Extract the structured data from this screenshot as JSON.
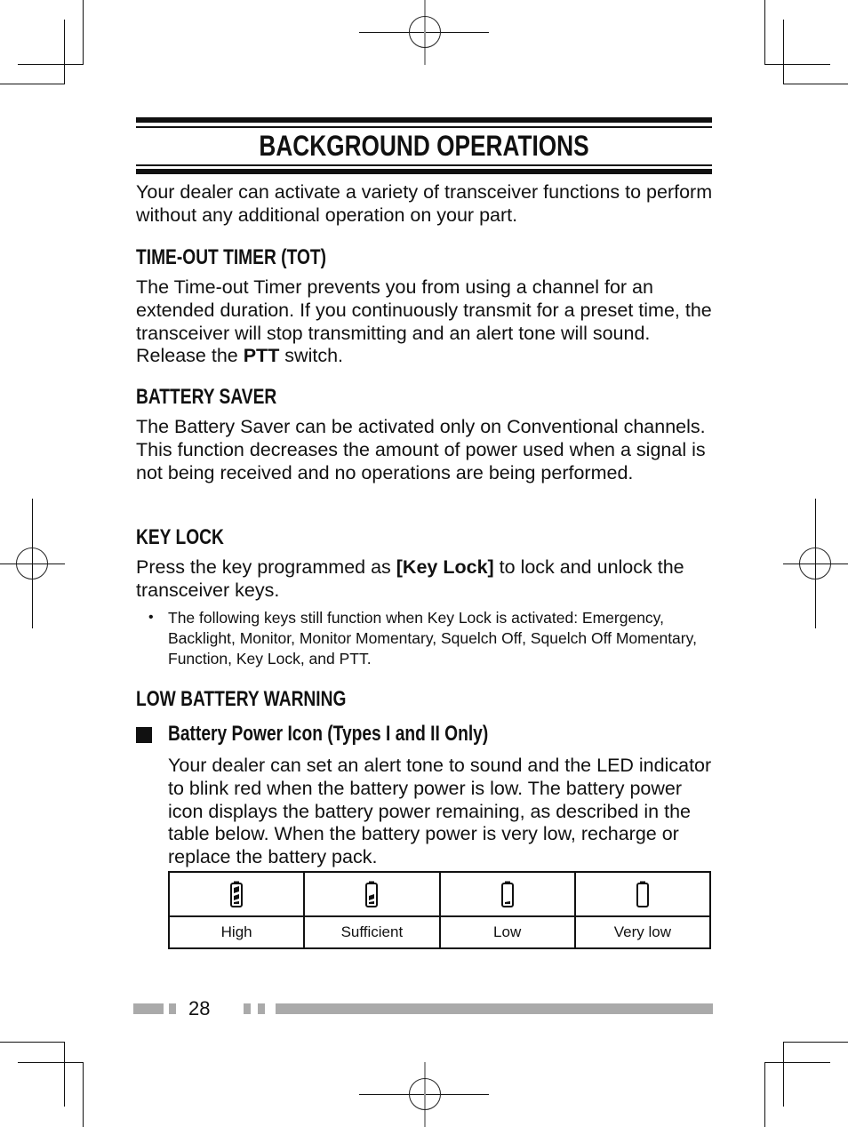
{
  "page": {
    "title": "BACKGROUND OPERATIONS",
    "intro": "Your dealer can activate a variety of transceiver functions to perform without any additional operation on your part.",
    "sections": [
      {
        "heading": "TIME-OUT TIMER (TOT)",
        "body_pre": "The Time-out Timer prevents you from using a channel for an extended duration.  If you continuously transmit for a preset time, the transceiver will stop transmitting and an alert tone will sound.  Release the ",
        "body_bold": "PTT",
        "body_post": " switch."
      },
      {
        "heading": "BATTERY SAVER",
        "body": "The Battery Saver can be activated only on Conventional channels.  This function decreases the amount of power used when a signal is not being received and no operations are being performed."
      },
      {
        "heading": "KEY LOCK",
        "body_pre": "Press the key programmed as ",
        "body_bold": "[Key Lock]",
        "body_post": " to lock and unlock the transceiver keys.",
        "bullet_mark": "•",
        "bullet": "The following keys still function when Key Lock is activated: Emergency, Backlight, Monitor, Monitor Momentary, Squelch Off, Squelch Off Momentary, Function, Key Lock, and PTT."
      },
      {
        "heading": "LOW BATTERY WARNING",
        "subheading": "Battery Power Icon (Types I and II Only)",
        "body": "Your dealer can set an alert tone to sound and the LED indicator to blink red when the battery power is low.  The battery power icon displays the battery power remaining, as described in the table below.  When the battery power is very low, recharge or replace the battery pack."
      }
    ],
    "battery_table": [
      {
        "icon": "battery-high-icon",
        "label": "High",
        "bars": 3
      },
      {
        "icon": "battery-sufficient-icon",
        "label": "Sufficient",
        "bars": 2
      },
      {
        "icon": "battery-low-icon",
        "label": "Low",
        "bars": 1
      },
      {
        "icon": "battery-very-low-icon",
        "label": "Very low",
        "bars": 0
      }
    ],
    "page_number": "28"
  }
}
